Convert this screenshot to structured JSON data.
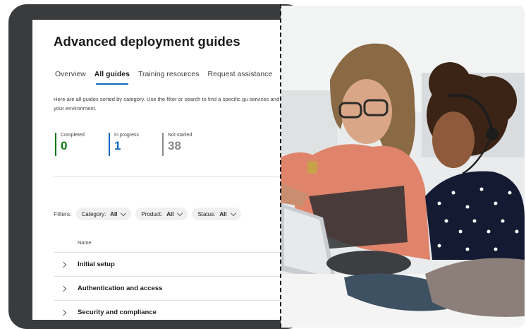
{
  "page": {
    "title": "Advanced deployment guides",
    "tabs": [
      {
        "label": "Overview",
        "active": false
      },
      {
        "label": "All guides",
        "active": true
      },
      {
        "label": "Training resources",
        "active": false
      },
      {
        "label": "Request assistance",
        "active": false
      }
    ],
    "description": "Here are all guides sorted by category. Use the filter or search to find a specific gu services and features to your environment.",
    "stats": [
      {
        "label": "Completed",
        "value": "0",
        "color": "#107c10"
      },
      {
        "label": "In progress",
        "value": "1",
        "color": "#0f6cbd"
      },
      {
        "label": "Not started",
        "value": "38",
        "color": "#8a8a8a"
      }
    ],
    "filters": {
      "label": "Filters:",
      "items": [
        {
          "name": "Category:",
          "value": "All"
        },
        {
          "name": "Product:",
          "value": "All"
        },
        {
          "name": "Status:",
          "value": "All"
        }
      ]
    },
    "table": {
      "column_header": "Name",
      "rows": [
        "Initial setup",
        "Authentication and access",
        "Security and compliance"
      ]
    }
  },
  "colors": {
    "accent": "#0f6cbd",
    "completed": "#107c10",
    "not_started": "#8a8a8a",
    "device_frame": "#3a3b3d"
  },
  "photo": {
    "subject": "two-women-at-laptop-photo"
  }
}
